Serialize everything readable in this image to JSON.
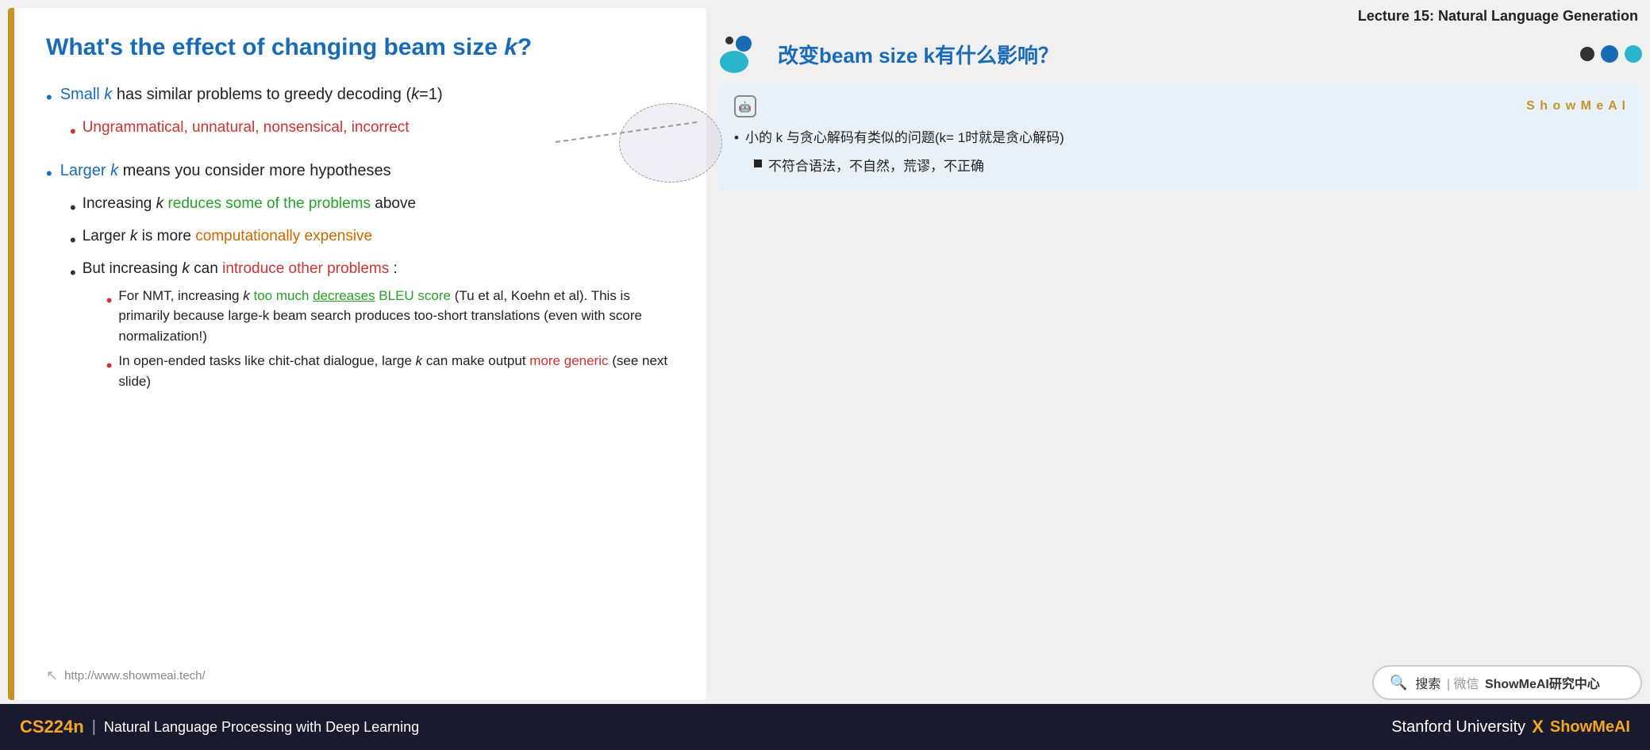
{
  "lecture": {
    "title": "Lecture 15: Natural Language Generation"
  },
  "slide": {
    "title_part1": "What's the effect of changing beam size ",
    "title_k": "k",
    "title_part2": "?",
    "bullets": [
      {
        "color": "blue",
        "text_before": "Small ",
        "k": "k",
        "text_after": " has similar problems to greedy decoding (",
        "k2": "k",
        "text_end": "=1)",
        "subbullets": [
          {
            "color": "red",
            "text": "Ungrammatical, unnatural, nonsensical, incorrect"
          }
        ]
      },
      {
        "color": "blue",
        "text_before": "Larger ",
        "k": "k",
        "text_after": " means you consider more hypotheses",
        "subbullets": [
          {
            "color": "dark",
            "text_before": "Increasing ",
            "k": "k",
            "text_green": " reduces some of the problems",
            "text_after": " above"
          },
          {
            "color": "dark",
            "text_before": "Larger ",
            "k": "k",
            "text_before2": " is more ",
            "text_orange": "computationally expensive"
          },
          {
            "color": "dark",
            "text_before": "But increasing ",
            "k": "k",
            "text_before2": " can ",
            "text_red": "introduce other problems",
            "text_after": ":",
            "subsubbullets": [
              {
                "text_before": "For NMT, increasing ",
                "k": "k",
                "text_green": " too much ",
                "text_underline": "decreases",
                "text_after": " BLEU score (Tu et al, Koehn et al). This is primarily because large-k beam search produces too-short translations (even with score normalization!)"
              },
              {
                "text_before": "In open-ended tasks like chit-chat dialogue, large ",
                "k": "k",
                "text_before2": " can make output ",
                "text_red": "more generic",
                "text_after": " (see next slide)"
              }
            ]
          }
        ]
      }
    ],
    "url": "http://www.showmeai.tech/"
  },
  "right_panel": {
    "chinese_title": "改变beam size k有什么影响？",
    "showmeai_label": "S h o w M e A I",
    "chinese_bullet1": "小的 k 与贪心解码有类似的问题(k= 1时就是贪心解码)",
    "chinese_subbullet1": "不符合语法，不自然，荒谬，不正确"
  },
  "search": {
    "placeholder": "搜索 | 微信 ShowMeAI研究中心"
  },
  "bottom": {
    "cs224n": "CS224n",
    "separator": "|",
    "subtitle": "Natural Language Processing with Deep Learning",
    "stanford": "Stanford University",
    "x": "X",
    "showmeai": "ShowMeAI"
  }
}
